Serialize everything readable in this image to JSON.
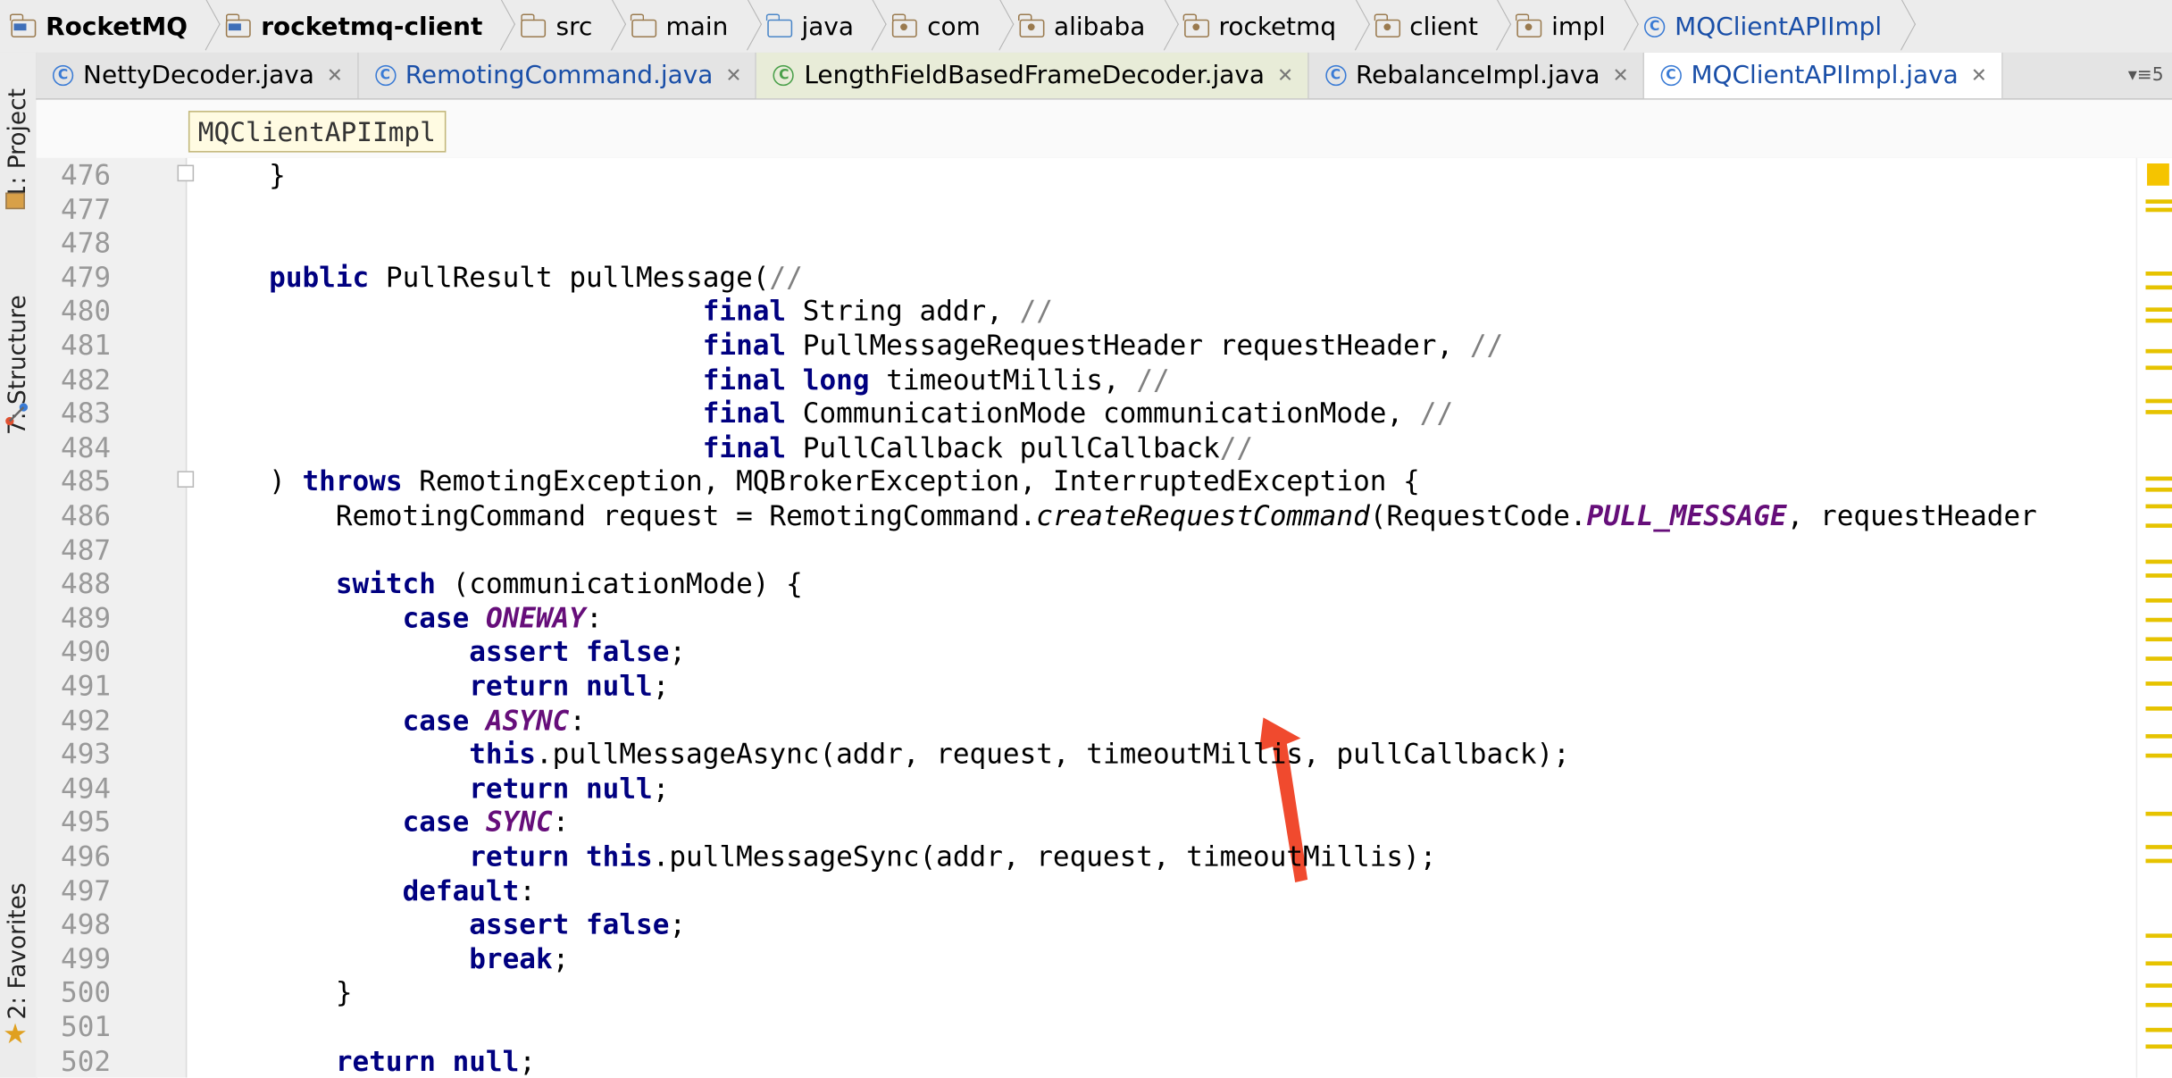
{
  "breadcrumbs": [
    {
      "label": "RocketMQ",
      "icon": "project-folder-icon",
      "bold": true
    },
    {
      "label": "rocketmq-client",
      "icon": "module-folder-icon",
      "bold": true
    },
    {
      "label": "src",
      "icon": "folder-icon"
    },
    {
      "label": "main",
      "icon": "folder-icon"
    },
    {
      "label": "java",
      "icon": "source-folder-icon"
    },
    {
      "label": "com",
      "icon": "package-icon"
    },
    {
      "label": "alibaba",
      "icon": "package-icon"
    },
    {
      "label": "rocketmq",
      "icon": "package-icon"
    },
    {
      "label": "client",
      "icon": "package-icon"
    },
    {
      "label": "impl",
      "icon": "package-icon"
    },
    {
      "label": "MQClientAPIImpl",
      "icon": "class-icon",
      "current": true
    }
  ],
  "tabs": [
    {
      "label": "NettyDecoder.java"
    },
    {
      "label": "RemotingCommand.java",
      "blue": true
    },
    {
      "label": "LengthFieldBasedFrameDecoder.java",
      "green": true
    },
    {
      "label": "RebalanceImpl.java"
    },
    {
      "label": "MQClientAPIImpl.java",
      "active": true
    }
  ],
  "tab_overflow": "5",
  "sidebar": {
    "project": "1: Project",
    "structure": "7: Structure",
    "favorites": "2: Favorites"
  },
  "editor_breadcrumb": "MQClientAPIImpl",
  "code_lines": [
    {
      "n": "476",
      "fold": true,
      "t": [
        [
          "    }",
          ""
        ]
      ]
    },
    {
      "n": "477",
      "t": []
    },
    {
      "n": "478",
      "t": []
    },
    {
      "n": "479",
      "t": [
        [
          "    ",
          ""
        ],
        [
          "public",
          "kw"
        ],
        [
          " PullResult pullMessage(",
          ""
        ],
        [
          "//",
          "cm"
        ]
      ]
    },
    {
      "n": "480",
      "t": [
        [
          "                              ",
          ""
        ],
        [
          "final",
          "kw"
        ],
        [
          " String addr, ",
          ""
        ],
        [
          "//",
          "cm"
        ]
      ]
    },
    {
      "n": "481",
      "t": [
        [
          "                              ",
          ""
        ],
        [
          "final",
          "kw"
        ],
        [
          " PullMessageRequestHeader requestHeader, ",
          ""
        ],
        [
          "//",
          "cm"
        ]
      ]
    },
    {
      "n": "482",
      "t": [
        [
          "                              ",
          ""
        ],
        [
          "final",
          "kw"
        ],
        [
          " ",
          ""
        ],
        [
          "long",
          "kw"
        ],
        [
          " timeoutMillis, ",
          ""
        ],
        [
          "//",
          "cm"
        ]
      ]
    },
    {
      "n": "483",
      "t": [
        [
          "                              ",
          ""
        ],
        [
          "final",
          "kw"
        ],
        [
          " CommunicationMode communicationMode, ",
          ""
        ],
        [
          "//",
          "cm"
        ]
      ]
    },
    {
      "n": "484",
      "t": [
        [
          "                              ",
          ""
        ],
        [
          "final",
          "kw"
        ],
        [
          " PullCallback pullCallback",
          ""
        ],
        [
          "//",
          "cm"
        ]
      ]
    },
    {
      "n": "485",
      "fold": true,
      "t": [
        [
          "    ) ",
          ""
        ],
        [
          "throws",
          "kw"
        ],
        [
          " RemotingException, MQBrokerException, InterruptedException {",
          ""
        ]
      ]
    },
    {
      "n": "486",
      "t": [
        [
          "        RemotingCommand request = RemotingCommand.",
          ""
        ],
        [
          "createRequestCommand",
          "it"
        ],
        [
          "(RequestCode.",
          ""
        ],
        [
          "PULL_MESSAGE",
          "cst"
        ],
        [
          ", requestHeader",
          ""
        ]
      ]
    },
    {
      "n": "487",
      "t": []
    },
    {
      "n": "488",
      "t": [
        [
          "        ",
          ""
        ],
        [
          "switch",
          "kw"
        ],
        [
          " (communicationMode) {",
          ""
        ]
      ]
    },
    {
      "n": "489",
      "t": [
        [
          "            ",
          ""
        ],
        [
          "case",
          "kw"
        ],
        [
          " ",
          ""
        ],
        [
          "ONEWAY",
          "cst"
        ],
        [
          ":",
          ""
        ]
      ]
    },
    {
      "n": "490",
      "t": [
        [
          "                ",
          ""
        ],
        [
          "assert false",
          "kw"
        ],
        [
          ";",
          ""
        ]
      ]
    },
    {
      "n": "491",
      "t": [
        [
          "                ",
          ""
        ],
        [
          "return null",
          "kw"
        ],
        [
          ";",
          ""
        ]
      ]
    },
    {
      "n": "492",
      "t": [
        [
          "            ",
          ""
        ],
        [
          "case",
          "kw"
        ],
        [
          " ",
          ""
        ],
        [
          "ASYNC",
          "cst"
        ],
        [
          ":",
          ""
        ]
      ]
    },
    {
      "n": "493",
      "t": [
        [
          "                ",
          ""
        ],
        [
          "this",
          "kw"
        ],
        [
          ".pullMessageAsync(addr, request, timeoutMillis, pullCallback);",
          ""
        ]
      ]
    },
    {
      "n": "494",
      "t": [
        [
          "                ",
          ""
        ],
        [
          "return null",
          "kw"
        ],
        [
          ";",
          ""
        ]
      ]
    },
    {
      "n": "495",
      "t": [
        [
          "            ",
          ""
        ],
        [
          "case",
          "kw"
        ],
        [
          " ",
          ""
        ],
        [
          "SYNC",
          "cst"
        ],
        [
          ":",
          ""
        ]
      ]
    },
    {
      "n": "496",
      "t": [
        [
          "                ",
          ""
        ],
        [
          "return this",
          "kw"
        ],
        [
          ".pullMessageSync(addr, request, timeoutMillis);",
          ""
        ]
      ]
    },
    {
      "n": "497",
      "t": [
        [
          "            ",
          ""
        ],
        [
          "default",
          "kw"
        ],
        [
          ":",
          ""
        ]
      ]
    },
    {
      "n": "498",
      "t": [
        [
          "                ",
          ""
        ],
        [
          "assert false",
          "kw"
        ],
        [
          ";",
          ""
        ]
      ]
    },
    {
      "n": "499",
      "t": [
        [
          "                ",
          ""
        ],
        [
          "break",
          "kw"
        ],
        [
          ";",
          ""
        ]
      ]
    },
    {
      "n": "500",
      "t": [
        [
          "        }",
          ""
        ]
      ]
    },
    {
      "n": "501",
      "t": []
    },
    {
      "n": "502",
      "t": [
        [
          "        ",
          ""
        ],
        [
          "return null",
          "kw"
        ],
        [
          ";",
          ""
        ]
      ]
    }
  ],
  "colors": {
    "accent_blue": "#1a4fa8",
    "keyword": "#000080",
    "constant": "#660e7a",
    "comment": "#808080",
    "arrow": "#f04a2e",
    "marker": "#e6c300"
  }
}
